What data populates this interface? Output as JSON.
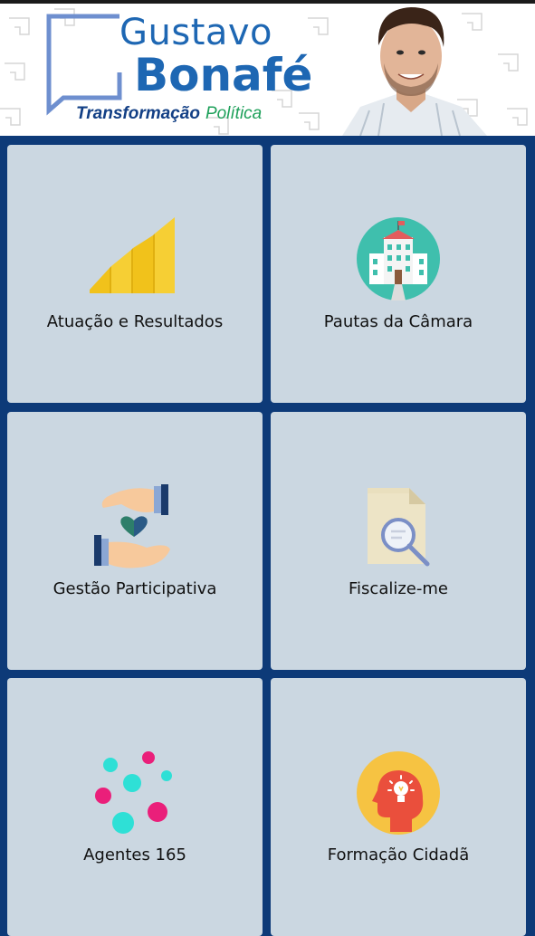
{
  "header": {
    "brand_first": "Gustavo",
    "brand_last": "Bonafé",
    "tagline_part1": "Transformação",
    "tagline_part2": "Política"
  },
  "tiles": [
    {
      "label": "Atuação e Resultados",
      "icon": "bar-growth-icon"
    },
    {
      "label": "Pautas da Câmara",
      "icon": "city-hall-icon"
    },
    {
      "label": "Gestão Participativa",
      "icon": "hands-heart-icon"
    },
    {
      "label": "Fiscalize-me",
      "icon": "document-search-icon"
    },
    {
      "label": "Agentes 165",
      "icon": "dots-network-icon"
    },
    {
      "label": "Formação Cidadã",
      "icon": "head-idea-icon"
    }
  ],
  "colors": {
    "background": "#0d3a78",
    "tile": "#cbd7e1",
    "brand_blue": "#1e67b3",
    "brand_green": "#1ea05a"
  }
}
